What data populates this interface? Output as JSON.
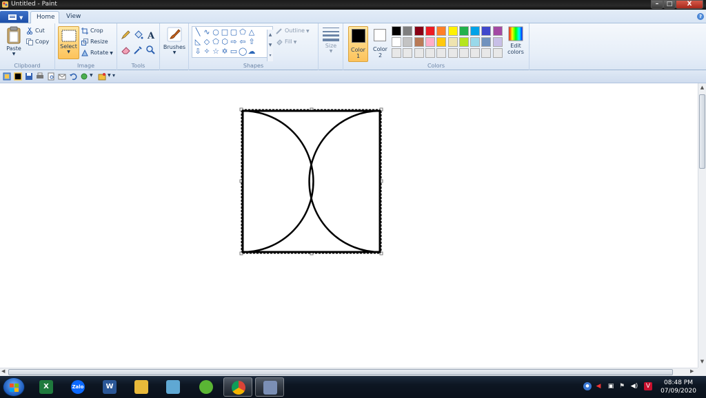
{
  "window": {
    "title": "Untitled - Paint"
  },
  "tabs": [
    {
      "label": "Home"
    },
    {
      "label": "View"
    }
  ],
  "clipboard": {
    "group_label": "Clipboard",
    "paste": "Paste",
    "cut": "Cut",
    "copy": "Copy"
  },
  "image": {
    "group_label": "Image",
    "select": "Select",
    "crop": "Crop",
    "resize": "Resize",
    "rotate": "Rotate"
  },
  "tools": {
    "group_label": "Tools"
  },
  "brushes": {
    "label": "Brushes"
  },
  "shapes": {
    "group_label": "Shapes",
    "outline": "Outline",
    "fill": "Fill"
  },
  "size": {
    "label": "Size"
  },
  "colors": {
    "group_label": "Colors",
    "color1": "Color\n1",
    "color1_a": "Color",
    "color1_b": "1",
    "color2_a": "Color",
    "color2_b": "2",
    "edit_a": "Edit",
    "edit_b": "colors",
    "palette_row1": [
      "#000000",
      "#7f7f7f",
      "#880015",
      "#ed1c24",
      "#ff7f27",
      "#fff200",
      "#22b14c",
      "#00a2e8",
      "#3f48cc",
      "#a349a4"
    ],
    "palette_row2": [
      "#ffffff",
      "#c3c3c3",
      "#b97a57",
      "#ffaec9",
      "#ffc90e",
      "#efe4b0",
      "#b5e61d",
      "#99d9ea",
      "#7092be",
      "#c8bfe7"
    ],
    "palette_row3": [
      "#e8e8e8",
      "#e8e8e8",
      "#e8e8e8",
      "#e8e8e8",
      "#e8e8e8",
      "#e8e8e8",
      "#e8e8e8",
      "#e8e8e8",
      "#e8e8e8",
      "#e8e8e8"
    ]
  },
  "taskbar": {
    "apps": [
      {
        "name": "excel",
        "color": "#1f7a3d",
        "glyph": "X"
      },
      {
        "name": "zalo",
        "color": "#0a68ff",
        "glyph": "Zalo"
      },
      {
        "name": "word",
        "color": "#2b5797",
        "glyph": "W"
      },
      {
        "name": "explorer",
        "color": "#e8b93a",
        "glyph": ""
      },
      {
        "name": "notes",
        "color": "#5fa8d3",
        "glyph": ""
      },
      {
        "name": "green-app",
        "color": "#5ab534",
        "glyph": ""
      },
      {
        "name": "chrome",
        "color": "#dd4b39",
        "glyph": ""
      },
      {
        "name": "paint",
        "color": "#7b8fb5",
        "glyph": ""
      }
    ],
    "clock_time": "08:48 PM",
    "clock_date": "07/09/2020"
  }
}
